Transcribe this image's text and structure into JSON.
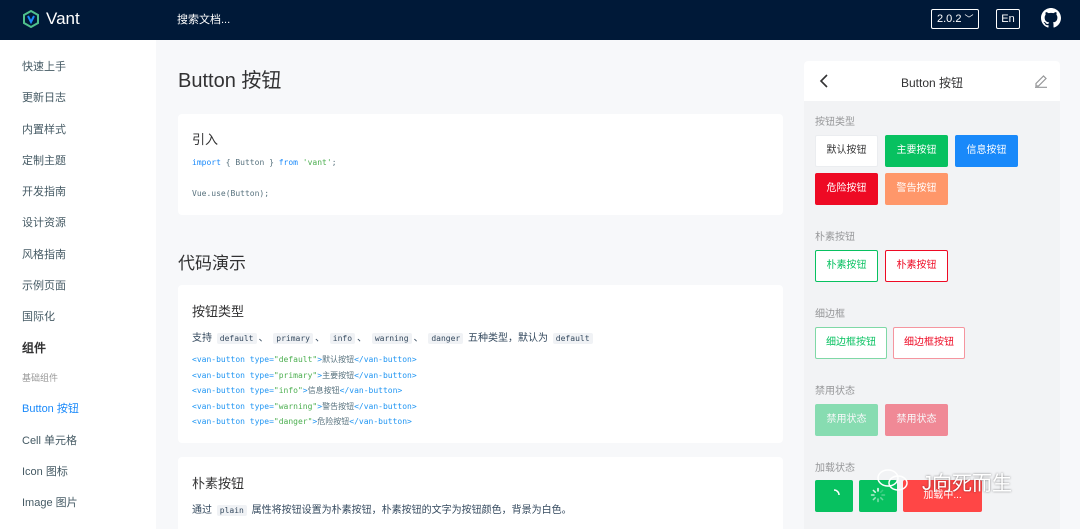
{
  "header": {
    "brand": "Vant",
    "search_placeholder": "搜索文档...",
    "version": "2.0.2",
    "lang": "En"
  },
  "sidebar": {
    "items": [
      {
        "label": "快速上手",
        "type": "item"
      },
      {
        "label": "更新日志",
        "type": "item"
      },
      {
        "label": "内置样式",
        "type": "item"
      },
      {
        "label": "定制主题",
        "type": "item"
      },
      {
        "label": "开发指南",
        "type": "item"
      },
      {
        "label": "设计资源",
        "type": "item"
      },
      {
        "label": "风格指南",
        "type": "item"
      },
      {
        "label": "示例页面",
        "type": "item"
      },
      {
        "label": "国际化",
        "type": "item"
      },
      {
        "label": "组件",
        "type": "group"
      },
      {
        "label": "基础组件",
        "type": "sub"
      },
      {
        "label": "Button 按钮",
        "type": "active"
      },
      {
        "label": "Cell 单元格",
        "type": "item"
      },
      {
        "label": "Icon 图标",
        "type": "item"
      },
      {
        "label": "Image 图片",
        "type": "item"
      }
    ]
  },
  "main": {
    "page_title": "Button 按钮",
    "import_card": {
      "title": "引入",
      "line1_kw1": "import",
      "line1_mid": " { Button } ",
      "line1_kw2": "from",
      "line1_str": " 'vant'",
      "line1_end": ";",
      "line2": "Vue.use(Button);"
    },
    "demo_title": "代码演示",
    "types_card": {
      "title": "按钮类型",
      "desc_pre": "支持",
      "desc_codes": [
        "default",
        "primary",
        "info",
        "warning",
        "danger"
      ],
      "desc_sep": "、",
      "desc_mid": "五种类型，默认为",
      "desc_default": "default",
      "code": [
        {
          "type": "default",
          "text": "默认按钮"
        },
        {
          "type": "primary",
          "text": "主要按钮"
        },
        {
          "type": "info",
          "text": "信息按钮"
        },
        {
          "type": "warning",
          "text": "警告按钮"
        },
        {
          "type": "danger",
          "text": "危险按钮"
        }
      ],
      "code_open": "<van-button type=",
      "code_close": "</van-button>"
    },
    "plain_card": {
      "title": "朴素按钮",
      "desc_pre": "通过",
      "desc_code": "plain",
      "desc_post": "属性将按钮设置为朴素按钮，朴素按钮的文字为按钮颜色，背景为白色。"
    }
  },
  "simulator": {
    "title": "Button 按钮",
    "sections": {
      "type": "按钮类型",
      "plain": "朴素按钮",
      "hairline": "细边框",
      "disabled": "禁用状态",
      "loading": "加载状态"
    },
    "buttons": {
      "default": "默认按钮",
      "primary": "主要按钮",
      "info": "信息按钮",
      "danger": "危险按钮",
      "warning": "警告按钮",
      "plain_primary": "朴素按钮",
      "plain_danger": "朴素按钮",
      "hair_primary": "细边框按钮",
      "hair_danger": "细边框按钮",
      "dis_primary": "禁用状态",
      "dis_danger": "禁用状态",
      "loading_text": "加载中..."
    }
  },
  "watermark": {
    "text": "J向死而生"
  },
  "colors": {
    "header_bg": "#001938",
    "primary": "#07c160",
    "info": "#1989fa",
    "danger": "#ee0a24",
    "warning": "#ff976a"
  }
}
